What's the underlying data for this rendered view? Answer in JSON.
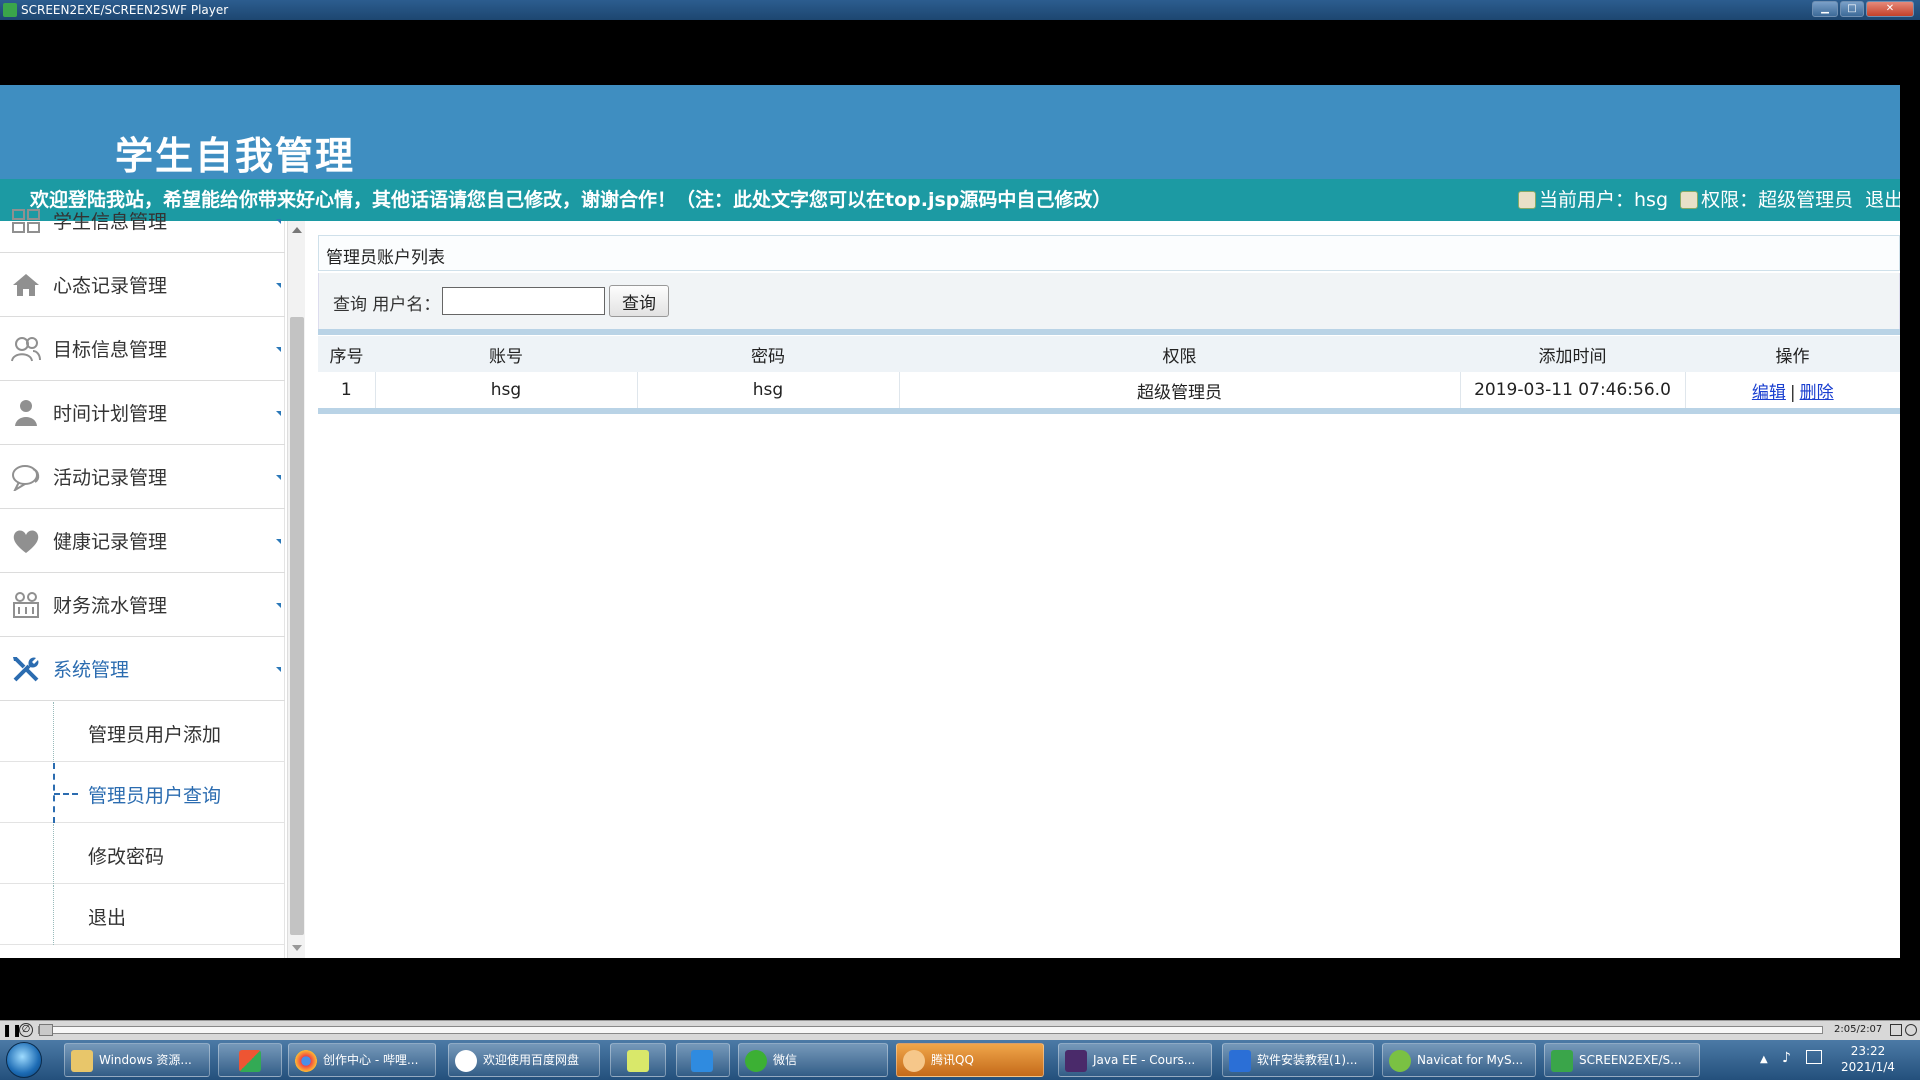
{
  "player": {
    "title": "SCREEN2EXE/SCREEN2SWF Player",
    "time": "2:05/2:07"
  },
  "site": {
    "title": "学生自我管理",
    "notice": "欢迎登陆我站，希望能给你带来好心情，其他话语请您自己修改，谢谢合作！（注：此处文字您可以在top.jsp源码中自己修改）",
    "current_user_label": "当前用户：hsg",
    "permission_label": "权限：超级管理员",
    "exit_label": "退出"
  },
  "sidebar": {
    "items": [
      {
        "label": "学生信息管理",
        "icon": "grid-icon"
      },
      {
        "label": "心态记录管理",
        "icon": "home-icon"
      },
      {
        "label": "目标信息管理",
        "icon": "users-icon"
      },
      {
        "label": "时间计划管理",
        "icon": "user-icon"
      },
      {
        "label": "活动记录管理",
        "icon": "chat-icon"
      },
      {
        "label": "健康记录管理",
        "icon": "heart-icon"
      },
      {
        "label": "财务流水管理",
        "icon": "finance-icon"
      },
      {
        "label": "系统管理",
        "icon": "tools-icon"
      }
    ],
    "subitems": [
      {
        "label": "管理员用户添加"
      },
      {
        "label": "管理员用户查询"
      },
      {
        "label": "修改密码"
      },
      {
        "label": "退出"
      }
    ]
  },
  "main": {
    "panel_title": "管理员账户列表",
    "search_label": "查询 用户名：",
    "search_value": "",
    "search_button": "查询",
    "columns": [
      "序号",
      "账号",
      "密码",
      "权限",
      "添加时间",
      "操作"
    ],
    "rows": [
      {
        "index": "1",
        "account": "hsg",
        "password": "hsg",
        "permission": "超级管理员",
        "added": "2019-03-11 07:46:56.0",
        "edit": "编辑",
        "sep": "|",
        "delete": "删除"
      }
    ]
  },
  "taskbar": {
    "items": [
      {
        "label": "Windows 资源..."
      },
      {
        "label": ""
      },
      {
        "label": "创作中心 - 哔哩..."
      },
      {
        "label": "欢迎使用百度网盘"
      },
      {
        "label": ""
      },
      {
        "label": ""
      },
      {
        "label": "微信"
      },
      {
        "label": "腾讯QQ"
      },
      {
        "label": "Java EE - Cours..."
      },
      {
        "label": "软件安装教程(1)..."
      },
      {
        "label": "Navicat for MyS..."
      },
      {
        "label": "SCREEN2EXE/S..."
      }
    ],
    "clock_time": "23:22",
    "clock_date": "2021/1/4"
  }
}
